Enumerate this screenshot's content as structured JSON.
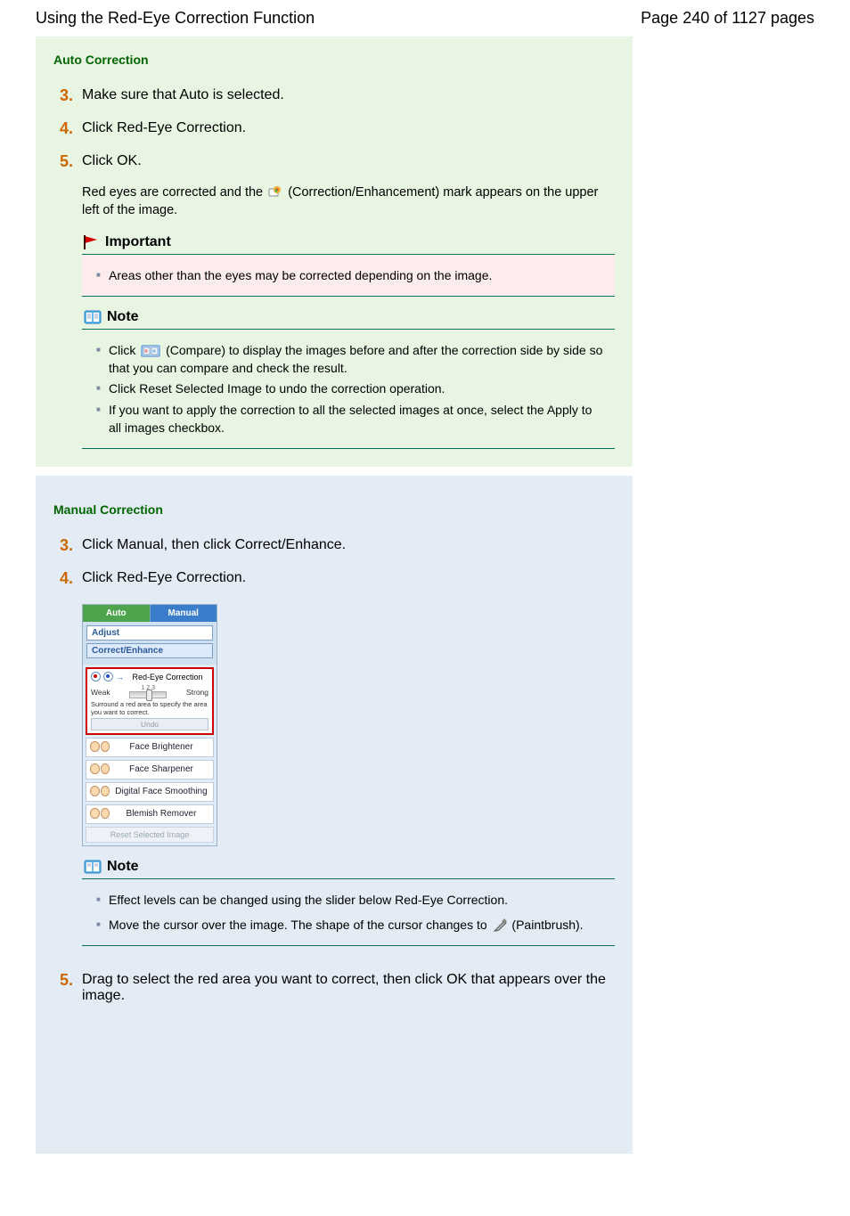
{
  "header": {
    "title": "Using the Red-Eye Correction Function",
    "pager": "Page 240 of 1127 pages"
  },
  "auto": {
    "title": "Auto Correction",
    "steps": {
      "s3": {
        "num": "3.",
        "text": "Make sure that Auto is selected."
      },
      "s4": {
        "num": "4.",
        "text": "Click Red-Eye Correction."
      },
      "s5": {
        "num": "5.",
        "text": "Click OK."
      }
    },
    "s5_detail_before": "Red eyes are corrected and the ",
    "s5_detail_after": " (Correction/Enhancement) mark appears on the upper left of the image.",
    "important": {
      "head": "Important",
      "item1": "Areas other than the eyes may be corrected depending on the image."
    },
    "note": {
      "head": "Note",
      "item1_before": "Click ",
      "item1_after": " (Compare) to display the images before and after the correction side by side so that you can compare and check the result.",
      "item2": "Click Reset Selected Image to undo the correction operation.",
      "item3": "If you want to apply the correction to all the selected images at once, select the Apply to all images checkbox."
    }
  },
  "manual": {
    "title": "Manual Correction",
    "steps": {
      "s3": {
        "num": "3.",
        "text": "Click Manual, then click Correct/Enhance."
      },
      "s4": {
        "num": "4.",
        "text": "Click Red-Eye Correction."
      },
      "s5": {
        "num": "5.",
        "text": "Drag to select the red area you want to correct, then click OK that appears over the image."
      }
    },
    "note": {
      "head": "Note",
      "item1": "Effect levels can be changed using the slider below Red-Eye Correction.",
      "item2_before": "Move the cursor over the image. The shape of the cursor changes to  ",
      "item2_after": " (Paintbrush)."
    },
    "panel": {
      "tab_auto": "Auto",
      "tab_manual": "Manual",
      "subtab_adjust": "Adjust",
      "subtab_correct": "Correct/Enhance",
      "redeye": "Red-Eye Correction",
      "weak": "Weak",
      "strong": "Strong",
      "ticks": "1   2   3",
      "hint": "Surround a red area to specify the area you want to correct.",
      "undo": "Undo",
      "face_bright": "Face Brightener",
      "face_sharp": "Face Sharpener",
      "face_smooth": "Digital Face Smoothing",
      "blemish": "Blemish Remover",
      "reset": "Reset Selected Image"
    }
  }
}
